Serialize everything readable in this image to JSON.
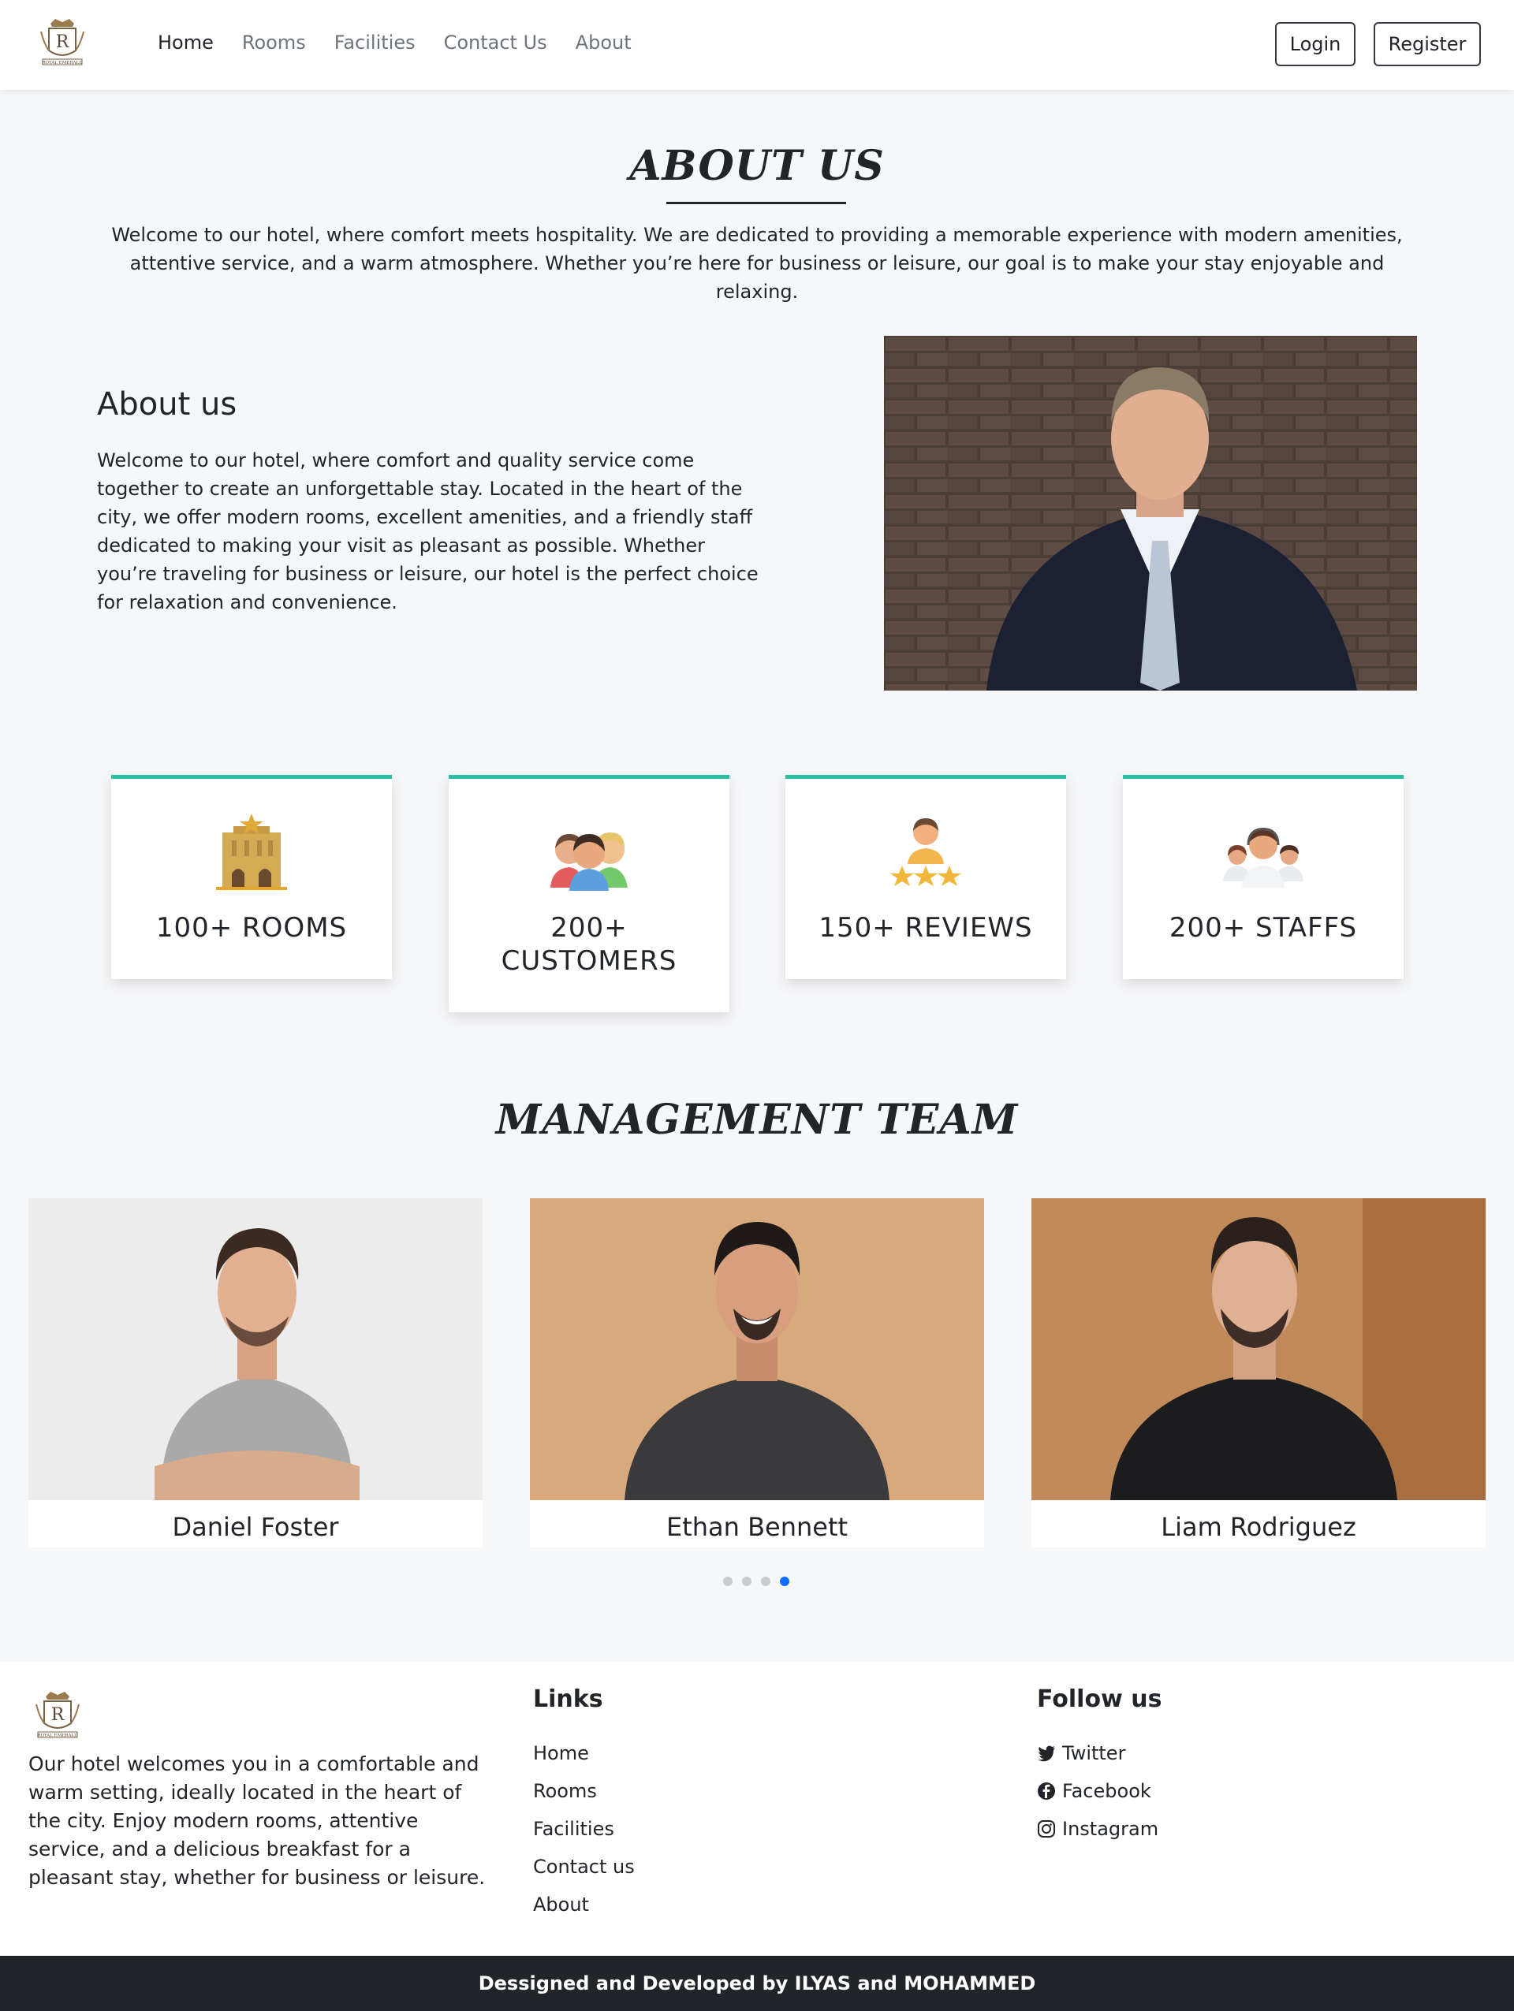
{
  "nav": {
    "logo_text": "ROYAL EMERALD",
    "links": [
      "Home",
      "Rooms",
      "Facilities",
      "Contact Us",
      "About"
    ],
    "login_label": "Login",
    "register_label": "Register"
  },
  "about": {
    "title": "ABOUT US",
    "intro": "Welcome to our hotel, where comfort meets hospitality. We are dedicated to providing a memorable experience with modern amenities, attentive service, and a warm atmosphere. Whether you’re here for business or leisure, our goal is to make your stay enjoyable and relaxing.",
    "subheading": "About us",
    "body": "Welcome to our hotel, where comfort and quality service come together to create an unforgettable stay. Located in the heart of the city, we offer modern rooms, excellent amenities, and a friendly staff dedicated to making your visit as pleasant as possible. Whether you’re traveling for business or leisure, our hotel is the perfect choice for relaxation and convenience."
  },
  "stats": [
    {
      "label": "100+ ROOMS",
      "icon": "hotel-building-icon"
    },
    {
      "label": "200+ CUSTOMERS",
      "icon": "customers-icon"
    },
    {
      "label": "150+ REVIEWS",
      "icon": "reviews-stars-icon"
    },
    {
      "label": "200+ STAFFS",
      "icon": "staff-icon"
    }
  ],
  "team": {
    "title": "MANAGEMENT TEAM",
    "members": [
      {
        "name": "Daniel Foster"
      },
      {
        "name": "Ethan Bennett"
      },
      {
        "name": "Liam Rodriguez"
      }
    ],
    "carousel_pages": 4,
    "active_page": 4
  },
  "footer": {
    "about": "Our hotel welcomes you in a comfortable and warm setting, ideally located in the heart of the city. Enjoy modern rooms, attentive service, and a delicious breakfast for a pleasant stay, whether for business or leisure.",
    "links_heading": "Links",
    "links": [
      "Home",
      "Rooms",
      "Facilities",
      "Contact us",
      "About"
    ],
    "follow_heading": "Follow us",
    "social": [
      {
        "label": "Twitter",
        "icon": "twitter-icon"
      },
      {
        "label": "Facebook",
        "icon": "facebook-icon"
      },
      {
        "label": "Instagram",
        "icon": "instagram-icon"
      }
    ],
    "copyright": "Dessigned and Developed by ILYAS and MOHAMMED"
  },
  "colors": {
    "accent": "#2bbfa4",
    "active_dot": "#0d6efd",
    "footer_bar": "#212529"
  }
}
